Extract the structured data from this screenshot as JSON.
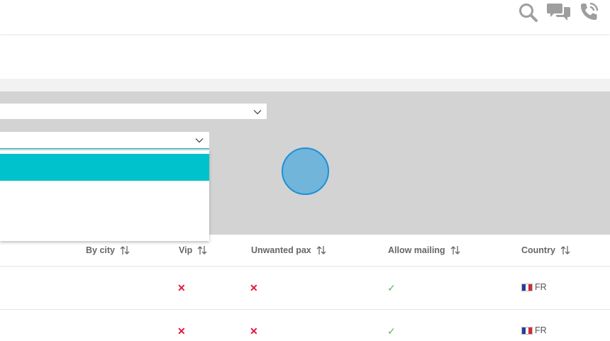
{
  "header": {
    "icons": [
      "search-icon",
      "chat-icon",
      "phone-icon"
    ]
  },
  "filters": {
    "select1_value": "",
    "select2_value": "",
    "dropdown_options": []
  },
  "table": {
    "columns": [
      {
        "label": "By city",
        "sortable": true
      },
      {
        "label": "Vip",
        "sortable": true
      },
      {
        "label": "Unwanted pax",
        "sortable": true
      },
      {
        "label": "Allow mailing",
        "sortable": true
      },
      {
        "label": "Country",
        "sortable": true
      }
    ],
    "rows": [
      {
        "by_city": "",
        "vip": "✕",
        "unwanted_pax": "✕",
        "allow_mailing": "✓",
        "country": "FR"
      },
      {
        "by_city": "",
        "vip": "✕",
        "unwanted_pax": "✕",
        "allow_mailing": "✓",
        "country": "FR"
      }
    ]
  },
  "colors": {
    "accent": "#00c2cc",
    "panel_gray": "#d3d3d3",
    "cross_red": "#e0183c",
    "check_green": "#5cb85c",
    "flag_blue": "#1f3f9a",
    "flag_white": "#ffffff",
    "flag_red": "#d62839"
  }
}
